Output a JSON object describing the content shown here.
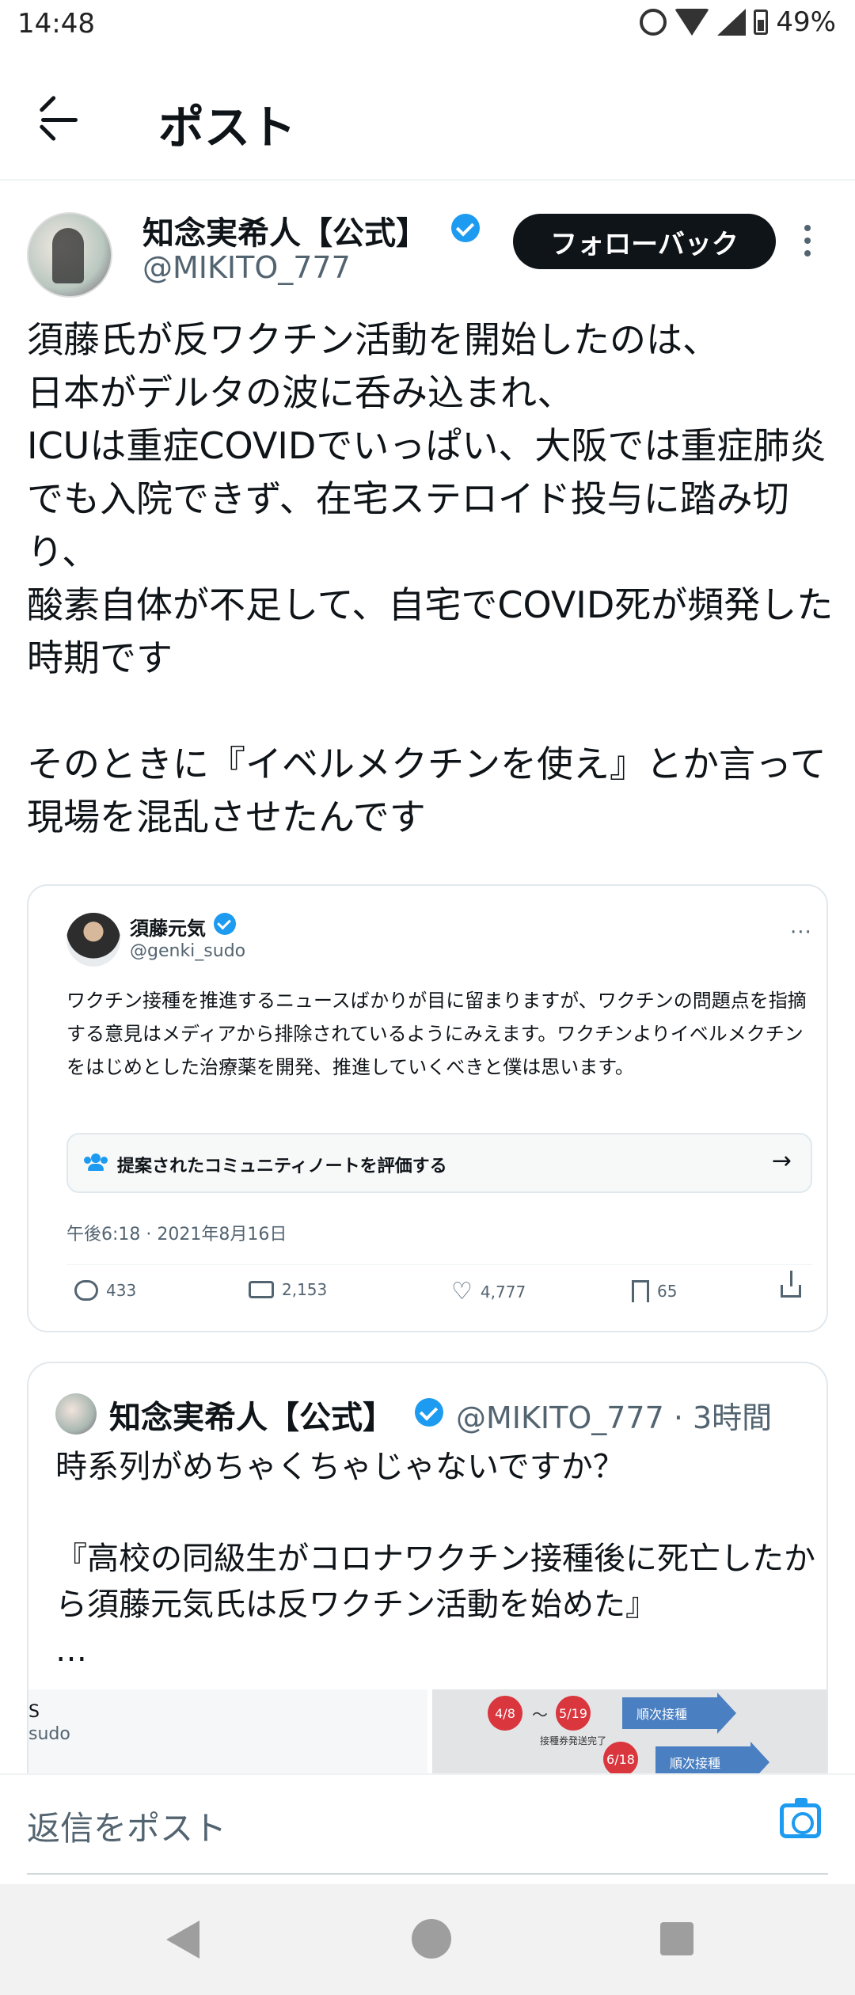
{
  "status_bar": {
    "time": "14:48",
    "battery": "49%"
  },
  "header": {
    "title": "ポスト"
  },
  "post": {
    "author_name": "知念実希人【公式】",
    "author_handle": "@MIKITO_777",
    "follow_label": "フォローバック",
    "body": "須藤氏が反ワクチン活動を開始したのは、\n日本がデルタの波に呑み込まれ、\nICUは重症COVIDでいっぱい、大阪では重症肺炎でも入院できず、在宅ステロイド投与に踏み切り、\n酸素自体が不足して、自宅でCOVID死が頻発した時期です\n\nそのときに『イベルメクチンを使え』とか言って現場を混乱させたんです"
  },
  "quoted": {
    "author_name": "須藤元気",
    "author_handle": "@genki_sudo",
    "more": "···",
    "body": "ワクチン接種を推進するニュースばかりが目に留まりますが、ワクチンの問題点を指摘する意見はメディアから排除されているようにみえます。ワクチンよりイベルメクチンをはじめとした治療薬を開発、推進していくべきと僕は思います。",
    "note_label": "提案されたコミュニティノートを評価する",
    "note_arrow": "→",
    "timestamp": "午後6:18 · 2021年8月16日",
    "stats": {
      "replies": "433",
      "retweets": "2,153",
      "likes": "4,777",
      "bookmarks": "65"
    }
  },
  "reply": {
    "author_name": "知念実希人【公式】",
    "meta": "@MIKITO_777 · 3時間",
    "body": "時系列がめちゃくちゃじゃないですか？\n\n『高校の同級生がコロナワクチン接種後に死亡したから須藤元気氏は反ワクチン活動を始めた』\n…",
    "media_left": {
      "line1": "S",
      "line2": "sudo"
    },
    "media_right": {
      "date1": "4/8",
      "tilde": "〜",
      "date2": "5/19",
      "date3": "6/18",
      "arrow1": "順次接種",
      "arrow2": "順次接種",
      "caption": "接種券発送完了"
    }
  },
  "reply_bar": {
    "placeholder": "返信をポスト"
  },
  "colors": {
    "accent": "#1d9bf0",
    "text": "#0f1419",
    "muted": "#536471"
  }
}
